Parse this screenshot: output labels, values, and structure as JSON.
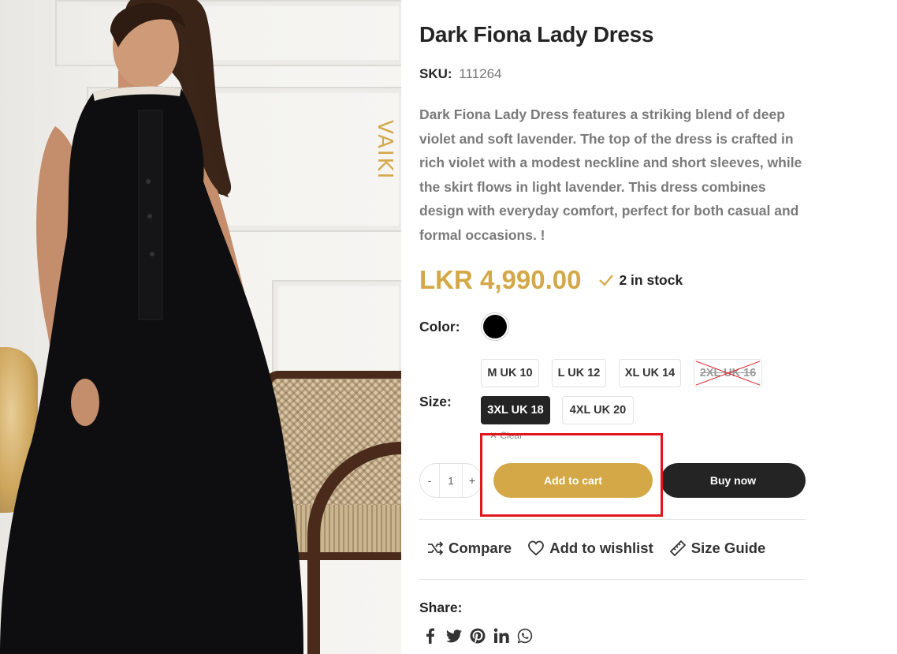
{
  "product": {
    "title": "Dark Fiona Lady Dress",
    "sku_label": "SKU:",
    "sku_value": "111264",
    "description": "Dark Fiona Lady Dress   features a striking blend of deep violet and soft lavender. The top of the dress is crafted in rich violet with a modest neckline and short sleeves, while the skirt flows in light lavender. This dress combines design with everyday comfort, perfect for both casual and formal occasions. !",
    "price": "LKR 4,990.00",
    "stock": "2 in stock",
    "brand_logo": "VAIKI"
  },
  "colors": {
    "accent": "#d4a847",
    "dark": "#242424",
    "highlight": "#e0181e"
  },
  "options": {
    "color_label": "Color:",
    "color_value": "#000000",
    "size_label": "Size:",
    "sizes": [
      {
        "label": "M UK 10",
        "state": "available"
      },
      {
        "label": "L UK 12",
        "state": "available"
      },
      {
        "label": "XL UK 14",
        "state": "available"
      },
      {
        "label": "2XL UK 16",
        "state": "unavailable"
      },
      {
        "label": "3XL UK 18",
        "state": "selected"
      },
      {
        "label": "4XL UK 20",
        "state": "available"
      }
    ],
    "clear_label": "Clear"
  },
  "cart": {
    "decrement": "-",
    "quantity": "1",
    "increment": "+",
    "add_to_cart": "Add to cart",
    "buy_now": "Buy now"
  },
  "actions": {
    "compare": "Compare",
    "wishlist": "Add to wishlist",
    "size_guide": "Size Guide"
  },
  "share": {
    "label": "Share:",
    "networks": [
      "facebook-icon",
      "twitter-icon",
      "pinterest-icon",
      "linkedin-icon",
      "whatsapp-icon"
    ]
  }
}
